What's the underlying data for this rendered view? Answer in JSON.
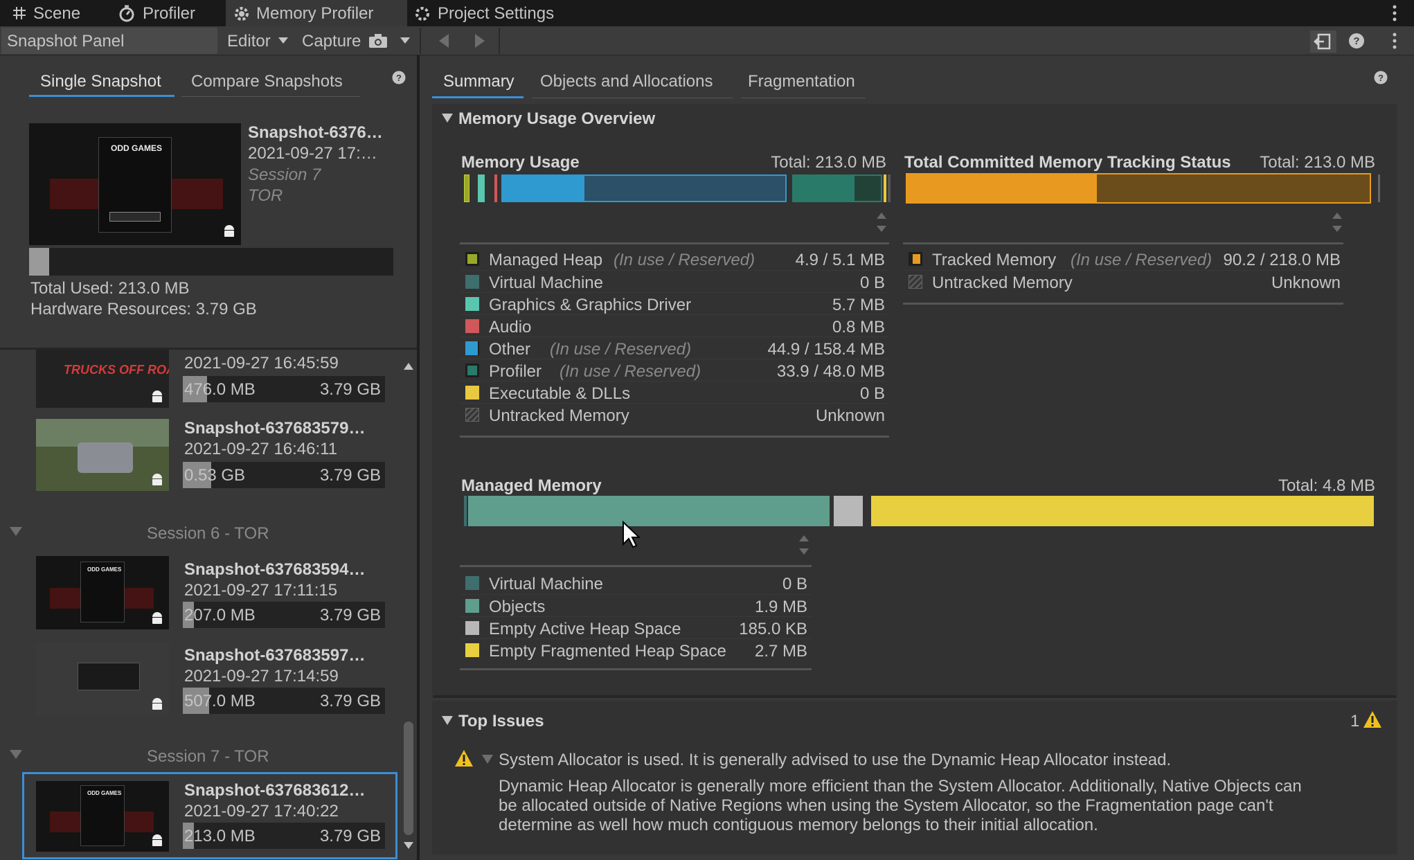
{
  "tabs": [
    {
      "label": "Scene",
      "icon": "grid-icon"
    },
    {
      "label": "Profiler",
      "icon": "stopwatch-icon"
    },
    {
      "label": "Memory Profiler",
      "icon": "gear-chip-icon"
    },
    {
      "label": "Project Settings",
      "icon": "gear-icon"
    }
  ],
  "toolbar": {
    "panel_label": "Snapshot Panel",
    "editor_label": "Editor",
    "capture_label": "Capture"
  },
  "left": {
    "tab_single": "Single Snapshot",
    "tab_compare": "Compare Snapshots",
    "selected": {
      "title": "Snapshot-6376…",
      "date": "2021-09-27 17:…",
      "session": "Session 7",
      "project": "TOR",
      "total_used": "Total Used: 213.0 MB",
      "hardware": "Hardware Resources: 3.79 GB",
      "thumb_text": "ODD GAMES",
      "usage_fraction": 0.056
    },
    "list": [
      {
        "title": "",
        "date": "2021-09-27 16:45:59",
        "used": "476.0 MB",
        "total": "3.79 GB",
        "fill": 0.12,
        "thumb": "TRUCKS OFF ROAD"
      },
      {
        "title": "Snapshot-637683579…",
        "date": "2021-09-27 16:46:11",
        "used": "0.53 GB",
        "total": "3.79 GB",
        "fill": 0.14,
        "thumb": ""
      },
      {
        "session": "Session 6 - TOR"
      },
      {
        "title": "Snapshot-637683594…",
        "date": "2021-09-27 17:11:15",
        "used": "207.0 MB",
        "total": "3.79 GB",
        "fill": 0.055,
        "thumb": "ODD GAMES"
      },
      {
        "title": "Snapshot-637683597…",
        "date": "2021-09-27 17:14:59",
        "used": "507.0 MB",
        "total": "3.79 GB",
        "fill": 0.13,
        "thumb": ""
      },
      {
        "session": "Session 7 - TOR"
      },
      {
        "title": "Snapshot-637683612…",
        "date": "2021-09-27 17:40:22",
        "used": "213.0 MB",
        "total": "3.79 GB",
        "fill": 0.056,
        "thumb": "ODD GAMES"
      }
    ]
  },
  "right": {
    "tabs": [
      "Summary",
      "Objects and Allocations",
      "Fragmentation"
    ],
    "overview_title": "Memory Usage Overview",
    "usage": {
      "title": "Memory Usage",
      "total": "Total: 213.0 MB",
      "rows": [
        {
          "name": "Managed Heap",
          "note": "(In use / Reserved)",
          "value": "4.9 / 5.1 MB",
          "color": "#9aa82a"
        },
        {
          "name": "Virtual Machine",
          "note": "",
          "value": "0 B",
          "color": "#3f6e6e"
        },
        {
          "name": "Graphics & Graphics Driver",
          "note": "",
          "value": "5.7 MB",
          "color": "#5ac6b0"
        },
        {
          "name": "Audio",
          "note": "",
          "value": "0.8 MB",
          "color": "#d0585a"
        },
        {
          "name": "Other",
          "note": "(In use / Reserved)",
          "value": "44.9 / 158.4 MB",
          "color": "#2f9ad0"
        },
        {
          "name": "Profiler",
          "note": "(In use / Reserved)",
          "value": "33.9 / 48.0 MB",
          "color": "#2a7a6a"
        },
        {
          "name": "Executable & DLLs",
          "note": "",
          "value": "0 B",
          "color": "#e8c940"
        },
        {
          "name": "Untracked Memory",
          "note": "",
          "value": "Unknown",
          "color": "#555555"
        }
      ]
    },
    "tracking": {
      "title": "Total Committed Memory Tracking Status",
      "total": "Total: 213.0 MB",
      "rows": [
        {
          "name": "Tracked Memory",
          "note": "(In use / Reserved)",
          "value": "90.2 / 218.0 MB",
          "color": "#e89a20"
        },
        {
          "name": "Untracked Memory",
          "note": "",
          "value": "Unknown",
          "color": "#555555"
        }
      ],
      "fill": 0.41
    },
    "managed": {
      "title": "Managed Memory",
      "total": "Total: 4.8 MB",
      "rows": [
        {
          "name": "Virtual Machine",
          "value": "0 B",
          "color": "#3f6e6e"
        },
        {
          "name": "Objects",
          "value": "1.9 MB",
          "color": "#5f9e8c"
        },
        {
          "name": "Empty Active Heap Space",
          "value": "185.0 KB",
          "color": "#b8b8b8"
        },
        {
          "name": "Empty Fragmented Heap Space",
          "value": "2.7 MB",
          "color": "#e8cf40"
        }
      ]
    },
    "issues": {
      "title": "Top Issues",
      "count": "1",
      "headline": "System Allocator is used. It is generally advised to use the Dynamic Heap Allocator instead.",
      "body": [
        "Dynamic Heap Allocator is generally more efficient than the System Allocator. Additionally, Native Objects can",
        "be allocated outside of Native Regions when using the System Allocator, so the Fragmentation page can't",
        "determine as well how much contiguous memory belongs to their initial allocation."
      ]
    }
  }
}
